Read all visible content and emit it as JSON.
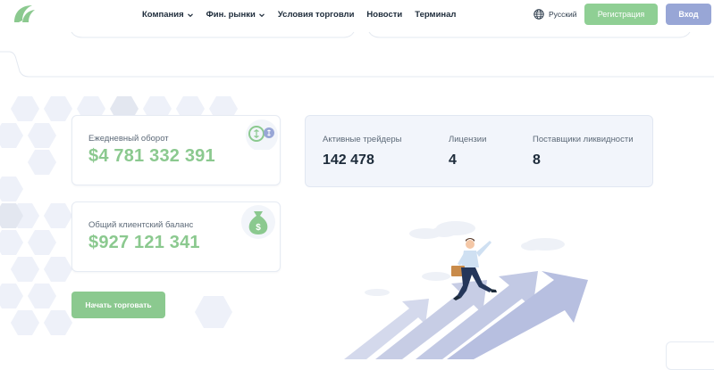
{
  "header": {
    "nav": [
      {
        "label": "Компания",
        "has_dropdown": true
      },
      {
        "label": "Фин. рынки",
        "has_dropdown": true
      },
      {
        "label": "Условия торговли",
        "has_dropdown": false
      },
      {
        "label": "Новости",
        "has_dropdown": false
      },
      {
        "label": "Терминал",
        "has_dropdown": false
      }
    ],
    "language": "Русский",
    "register_label": "Регистрация",
    "login_label": "Вход"
  },
  "cards": {
    "turnover": {
      "label": "Ежедневный оборот",
      "value": "$4 781 332 391",
      "icon": "exchange-dollar-icon"
    },
    "balance": {
      "label": "Общий клиентский баланс",
      "value": "$927 121 341",
      "icon": "money-bag-icon"
    }
  },
  "stats": [
    {
      "label": "Активные трейдеры",
      "value": "142 478"
    },
    {
      "label": "Лицензии",
      "value": "4"
    },
    {
      "label": "Поставщики ликвидности",
      "value": "8"
    }
  ],
  "cta": {
    "label": "Начать торговать"
  },
  "colors": {
    "brand_green": "#8bc98f",
    "login_blue": "#98a6d6",
    "text_dark": "#1d2b3a"
  }
}
